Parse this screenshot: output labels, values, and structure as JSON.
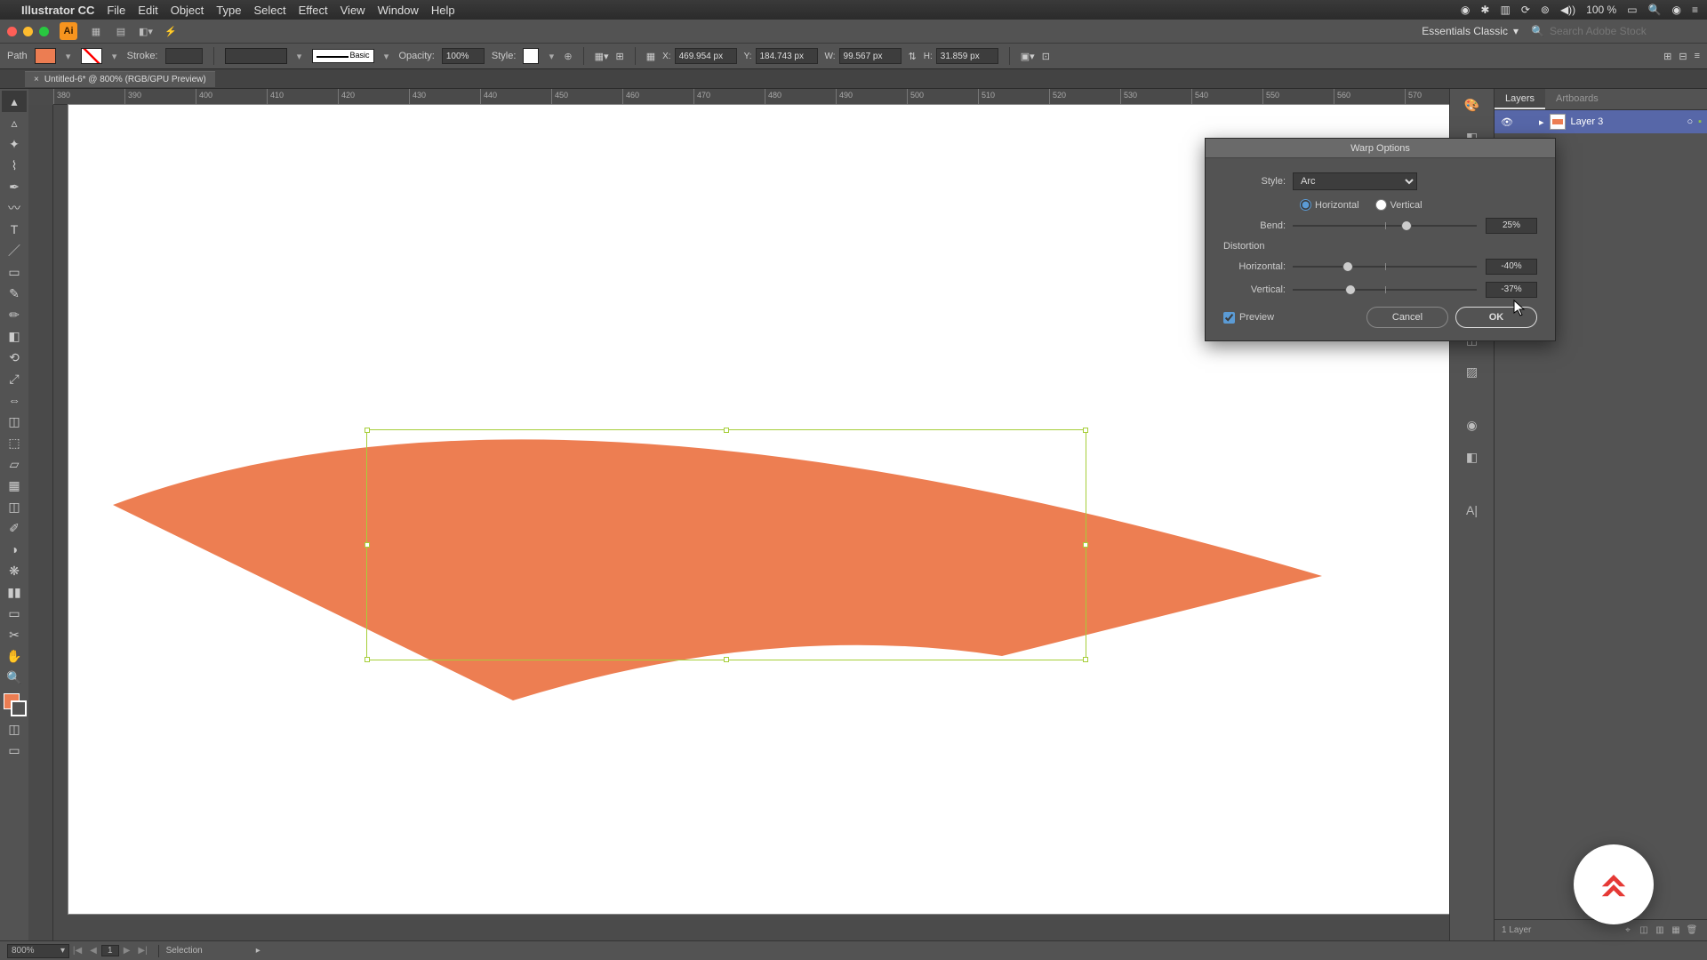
{
  "menubar": {
    "app": "Illustrator CC",
    "items": [
      "File",
      "Edit",
      "Object",
      "Type",
      "Select",
      "Effect",
      "View",
      "Window",
      "Help"
    ],
    "battery": "100 %",
    "battery_icon": "▮▮▯"
  },
  "topbar": {
    "workspace": "Essentials Classic",
    "search_placeholder": "Search Adobe Stock"
  },
  "control": {
    "selection_label": "Path",
    "fill_color": "#ec7d52",
    "stroke_label": "Stroke:",
    "stroke_weight": "",
    "brush_label": "Basic",
    "opacity_label": "Opacity:",
    "opacity_value": "100%",
    "style_label": "Style:",
    "x_label": "X:",
    "x_value": "469.954 px",
    "y_label": "Y:",
    "y_value": "184.743 px",
    "w_label": "W:",
    "w_value": "99.567 px",
    "h_label": "H:",
    "h_value": "31.859 px"
  },
  "doc_tab": {
    "title": "Untitled-6* @ 800% (RGB/GPU Preview)"
  },
  "ruler_ticks": [
    "380",
    "390",
    "400",
    "410",
    "420",
    "430",
    "440",
    "450",
    "460",
    "470",
    "480",
    "490",
    "500",
    "510",
    "520",
    "530",
    "540",
    "550",
    "560",
    "570"
  ],
  "dialog": {
    "title": "Warp Options",
    "style_label": "Style:",
    "style_value": "Arc",
    "horizontal_label": "Horizontal",
    "vertical_label": "Vertical",
    "bend_label": "Bend:",
    "bend_value": "25%",
    "distortion_label": "Distortion",
    "dh_label": "Horizontal:",
    "dh_value": "-40%",
    "dv_label": "Vertical:",
    "dv_value": "-37%",
    "preview_label": "Preview",
    "cancel": "Cancel",
    "ok": "OK"
  },
  "layers": {
    "tab_layers": "Layers",
    "tab_artboards": "Artboards",
    "layer_name": "Layer 3",
    "footer": "1 Layer"
  },
  "status": {
    "zoom": "800%",
    "page": "1",
    "mode": "Selection"
  }
}
